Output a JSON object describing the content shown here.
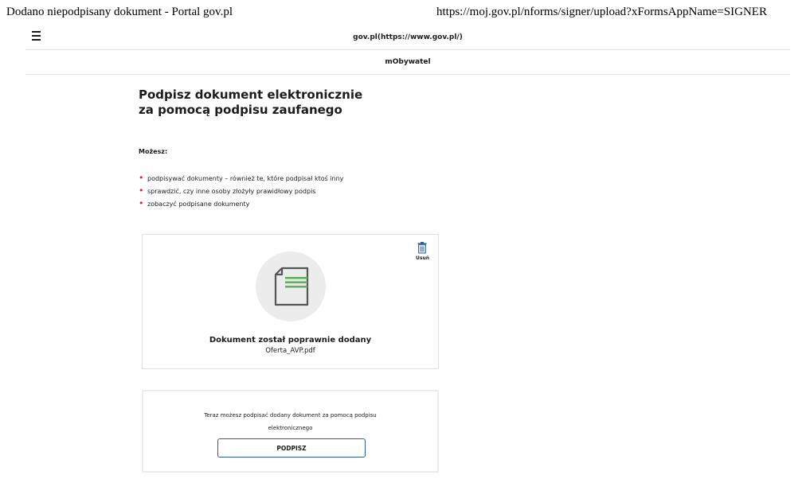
{
  "print_header": {
    "title": "Dodano niepodpisany dokument - Portal gov.pl",
    "url": "https://moj.gov.pl/nforms/signer/upload?xFormsAppName=SIGNER"
  },
  "nav": {
    "gov_link": "gov.pl(https://www.gov.pl/)",
    "brand": "mObywatel"
  },
  "main": {
    "heading_line1": "Podpisz dokument elektronicznie",
    "heading_line2": "za pomocą podpisu zaufanego",
    "intro": "Możesz:",
    "bullets": [
      "podpisywać dokumenty – również te, które podpisał ktoś inny",
      "sprawdzić, czy inne osoby złożyły prawidłowy podpis",
      "zobaczyć podpisane dokumenty"
    ]
  },
  "document_card": {
    "delete_label": "Usuń",
    "status": "Dokument został poprawnie dodany",
    "filename": "Oferta_AVP.pdf"
  },
  "sign_card": {
    "text_line1": "Teraz możesz podpisać dodany dokument za pomocą podpisu",
    "text_line2": "elektronicznego",
    "button_label": "PODPISZ"
  },
  "colors": {
    "accent_blue": "#2d5f91",
    "bullet_red": "#d5233f",
    "doc_green": "#5fb35a"
  }
}
